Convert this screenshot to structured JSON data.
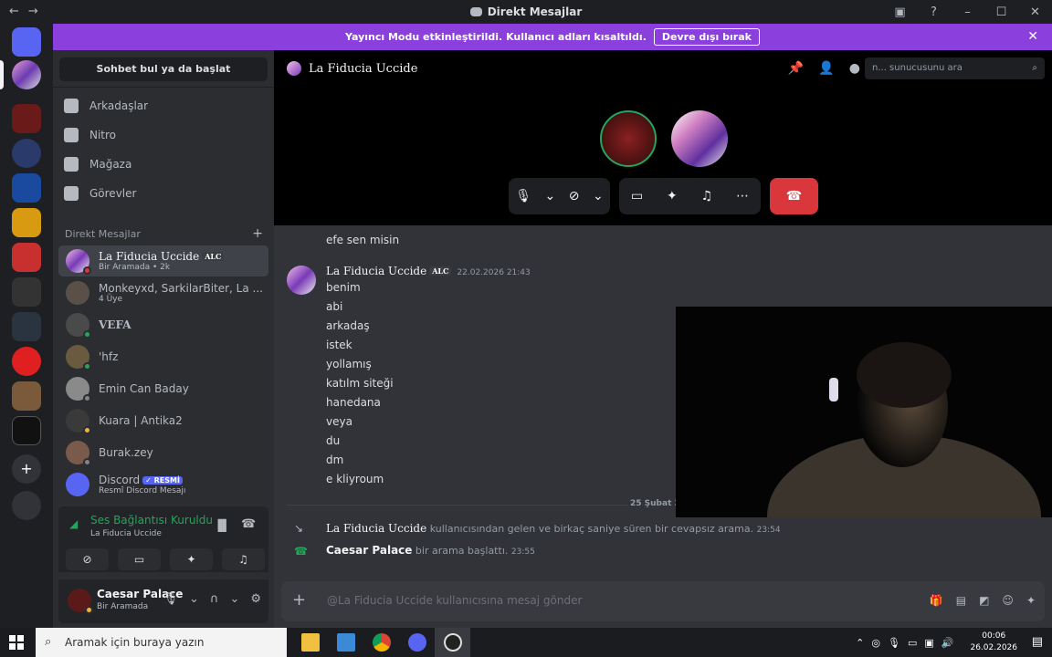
{
  "window": {
    "title": "Direkt Mesajlar",
    "back": "←",
    "forward": "→"
  },
  "banner": {
    "text": "Yayıncı Modu etkinleştirildi. Kullanıcı adları kısaltıldı.",
    "button": "Devre dışı bırak",
    "close": "✕"
  },
  "sidebar": {
    "search": "Sohbet bul ya da başlat",
    "nav": [
      "Arkadaşlar",
      "Nitro",
      "Mağaza",
      "Görevler"
    ],
    "dm_header": "Direkt Mesajlar",
    "dms": [
      {
        "name": "La Fiducia Uccide",
        "badge": "ALC",
        "sub": "Bir Aramada • 2k"
      },
      {
        "name": "Monkeyxd, SarkilarBiter, La ...",
        "sub": "4 Üye"
      },
      {
        "name": "VEFA",
        "sub": ""
      },
      {
        "name": "'hfz",
        "sub": ""
      },
      {
        "name": "Emin Can Baday",
        "sub": ""
      },
      {
        "name": "Kuara | Antika2",
        "sub": ""
      },
      {
        "name": "Burak.zey",
        "sub": ""
      },
      {
        "name": "Discord",
        "badge": "✓ RESMİ",
        "sub": "Resmî Discord Mesajı"
      }
    ]
  },
  "voice": {
    "status": "Ses Bağlantısı Kuruldu",
    "channel": "La Fiducia Uccide"
  },
  "user": {
    "name": "Caesar Palace",
    "status": "Bir Aramada"
  },
  "channel": {
    "name": "La Fiducia Uccide",
    "search_placeholder": "n... sunucusunu ara"
  },
  "messages": {
    "prev_line": "efe sen misin",
    "author": "La Fiducia Uccide",
    "author_badge": "ALC",
    "timestamp": "22.02.2026 21:43",
    "lines": [
      "benim",
      "abi",
      "arkadaş",
      "istek",
      "yollamış",
      "katılm siteği",
      "hanedana",
      "veya",
      "du",
      "dm",
      "e kliyroum"
    ],
    "date_divider": "25 Şubat 20",
    "system": [
      {
        "name": "La Fiducia Uccide",
        "text": "kullanıcısından gelen ve birkaç saniye süren bir cevapsız arama.",
        "time": "23:54"
      },
      {
        "name": "Caesar Palace",
        "text": "bir arama başlattı.",
        "time": "23:55"
      }
    ]
  },
  "composer": {
    "placeholder": "@La Fiducia Uccide kullanıcısına mesaj gönder"
  },
  "taskbar": {
    "search": "Aramak için buraya yazın",
    "time": "00:06",
    "date": "26.02.2026"
  },
  "colors": {
    "brand": "#5865f2",
    "banner": "#8b3fdd",
    "hangup": "#da373c",
    "online": "#23a55a"
  }
}
